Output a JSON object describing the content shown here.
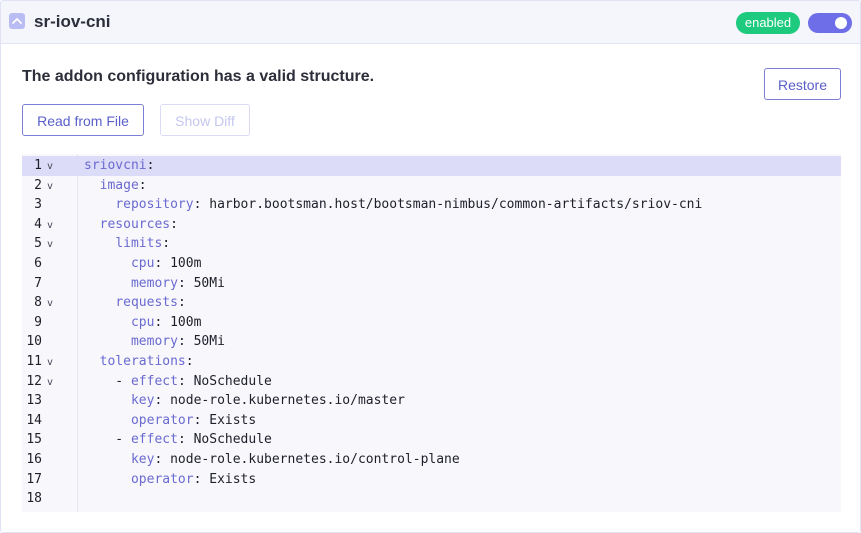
{
  "header": {
    "addon_name": "sr-iov-cni",
    "status": "enabled",
    "toggle_on": true
  },
  "message": "The addon configuration has a valid structure.",
  "buttons": {
    "restore": "Restore",
    "read_from_file": "Read from File",
    "show_diff": "Show Diff"
  },
  "colors": {
    "accent": "#6e6ee8",
    "status_green": "#1dca7e",
    "yaml_key": "#6a6ad0"
  },
  "editor": {
    "lines": [
      {
        "n": "1",
        "fold": true,
        "indent": "",
        "key": "sriovcni",
        "sep": ":",
        "value": ""
      },
      {
        "n": "2",
        "fold": true,
        "indent": "  ",
        "key": "image",
        "sep": ":",
        "value": ""
      },
      {
        "n": "3",
        "fold": false,
        "indent": "    ",
        "key": "repository",
        "sep": ": ",
        "value": "harbor.bootsman.host/bootsman-nimbus/common-artifacts/sriov-cni"
      },
      {
        "n": "4",
        "fold": true,
        "indent": "  ",
        "key": "resources",
        "sep": ":",
        "value": ""
      },
      {
        "n": "5",
        "fold": true,
        "indent": "    ",
        "key": "limits",
        "sep": ":",
        "value": ""
      },
      {
        "n": "6",
        "fold": false,
        "indent": "      ",
        "key": "cpu",
        "sep": ": ",
        "value": "100m"
      },
      {
        "n": "7",
        "fold": false,
        "indent": "      ",
        "key": "memory",
        "sep": ": ",
        "value": "50Mi"
      },
      {
        "n": "8",
        "fold": true,
        "indent": "    ",
        "key": "requests",
        "sep": ":",
        "value": ""
      },
      {
        "n": "9",
        "fold": false,
        "indent": "      ",
        "key": "cpu",
        "sep": ": ",
        "value": "100m"
      },
      {
        "n": "10",
        "fold": false,
        "indent": "      ",
        "key": "memory",
        "sep": ": ",
        "value": "50Mi"
      },
      {
        "n": "11",
        "fold": true,
        "indent": "  ",
        "key": "tolerations",
        "sep": ":",
        "value": ""
      },
      {
        "n": "12",
        "fold": true,
        "indent": "    - ",
        "key": "effect",
        "sep": ": ",
        "value": "NoSchedule"
      },
      {
        "n": "13",
        "fold": false,
        "indent": "      ",
        "key": "key",
        "sep": ": ",
        "value": "node-role.kubernetes.io/master"
      },
      {
        "n": "14",
        "fold": false,
        "indent": "      ",
        "key": "operator",
        "sep": ": ",
        "value": "Exists"
      },
      {
        "n": "15",
        "fold": false,
        "indent": "    - ",
        "key": "effect",
        "sep": ": ",
        "value": "NoSchedule"
      },
      {
        "n": "16",
        "fold": false,
        "indent": "      ",
        "key": "key",
        "sep": ": ",
        "value": "node-role.kubernetes.io/control-plane"
      },
      {
        "n": "17",
        "fold": false,
        "indent": "      ",
        "key": "operator",
        "sep": ": ",
        "value": "Exists"
      },
      {
        "n": "18",
        "fold": false,
        "indent": "",
        "key": "",
        "sep": "",
        "value": ""
      }
    ],
    "active_line": "1",
    "fold_glyph": "v"
  }
}
